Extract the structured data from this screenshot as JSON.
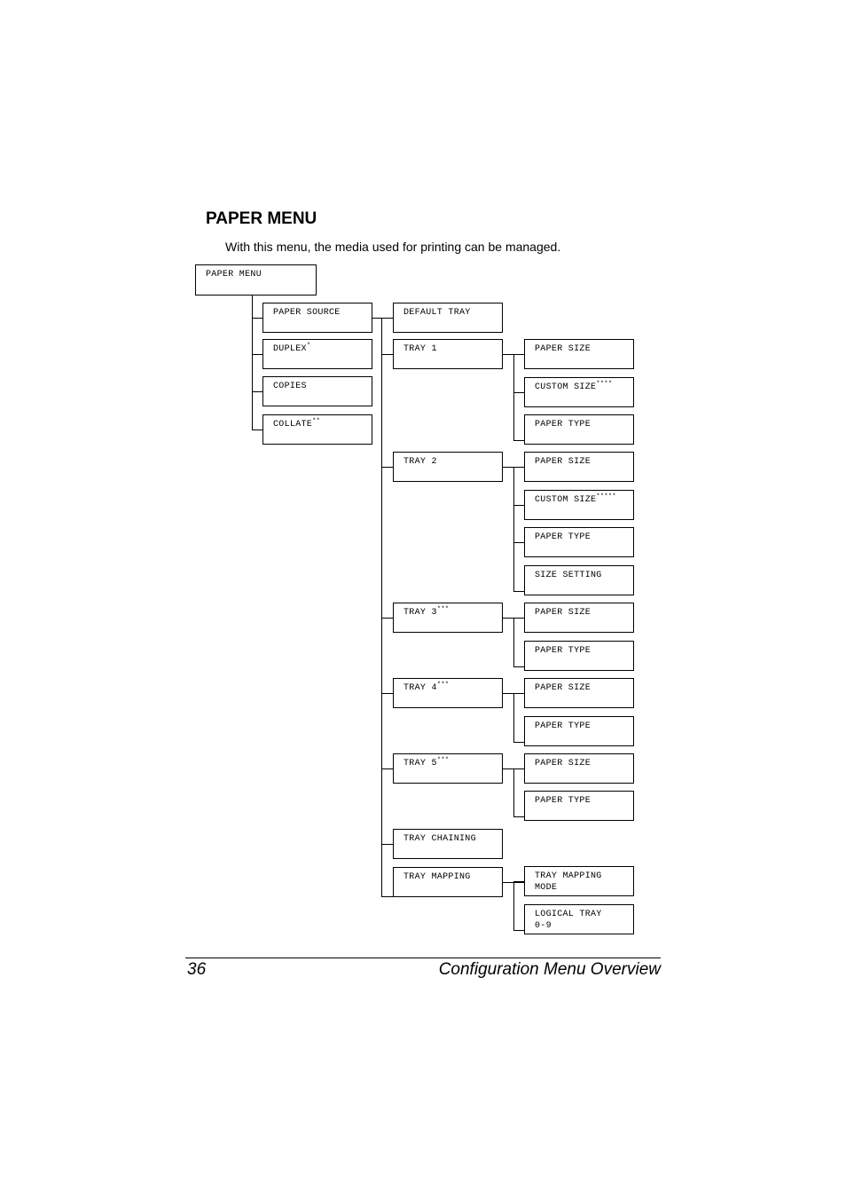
{
  "heading": "PAPER MENU",
  "intro": "With this menu, the media used for printing can be managed.",
  "tree": {
    "root": {
      "label": "PAPER MENU"
    },
    "level1": [
      {
        "label": "PAPER SOURCE",
        "sup": ""
      },
      {
        "label": "DUPLEX",
        "sup": "*"
      },
      {
        "label": "COPIES",
        "sup": ""
      },
      {
        "label": "COLLATE",
        "sup": "**"
      }
    ],
    "paper_source_items": [
      {
        "label": "DEFAULT TRAY",
        "sup": "",
        "children": []
      },
      {
        "label": "TRAY 1",
        "sup": "",
        "children": [
          {
            "label": "PAPER SIZE",
            "sup": ""
          },
          {
            "label": "CUSTOM SIZE",
            "sup": "****"
          },
          {
            "label": "PAPER TYPE",
            "sup": ""
          }
        ]
      },
      {
        "label": "TRAY 2",
        "sup": "",
        "children": [
          {
            "label": "PAPER SIZE",
            "sup": ""
          },
          {
            "label": "CUSTOM SIZE",
            "sup": "*****"
          },
          {
            "label": "PAPER TYPE",
            "sup": ""
          },
          {
            "label": "SIZE SETTING",
            "sup": ""
          }
        ]
      },
      {
        "label": "TRAY 3",
        "sup": "***",
        "children": [
          {
            "label": "PAPER SIZE",
            "sup": ""
          },
          {
            "label": "PAPER TYPE",
            "sup": ""
          }
        ]
      },
      {
        "label": "TRAY 4",
        "sup": "***",
        "children": [
          {
            "label": "PAPER SIZE",
            "sup": ""
          },
          {
            "label": "PAPER TYPE",
            "sup": ""
          }
        ]
      },
      {
        "label": "TRAY 5",
        "sup": "***",
        "children": [
          {
            "label": "PAPER SIZE",
            "sup": ""
          },
          {
            "label": "PAPER TYPE",
            "sup": ""
          }
        ]
      },
      {
        "label": "TRAY CHAINING",
        "sup": "",
        "children": []
      },
      {
        "label": "TRAY MAPPING",
        "sup": "",
        "children": [
          {
            "label": "TRAY MAPPING\nMODE",
            "sup": ""
          },
          {
            "label": "LOGICAL TRAY\n0-9",
            "sup": ""
          }
        ]
      }
    ]
  },
  "footer": {
    "page_number": "36",
    "section_title": "Configuration Menu Overview"
  }
}
